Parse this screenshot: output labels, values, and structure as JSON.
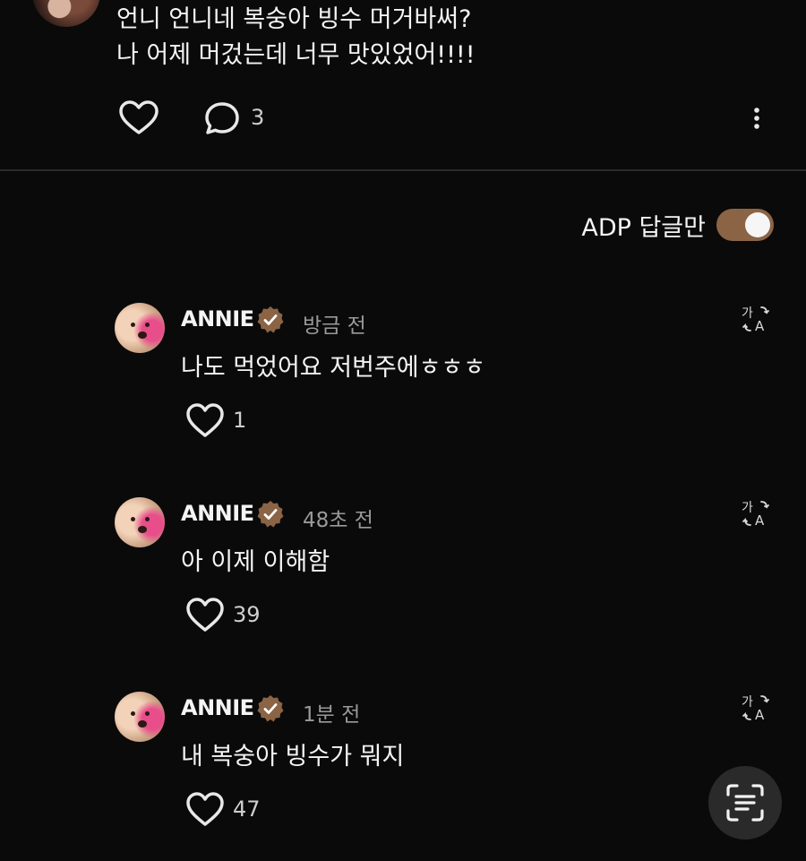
{
  "post": {
    "text": "언니 언니네 복숭아 빙수 머거바써?\n나 어제 머겄는데 너무 맛있었어!!!!",
    "reply_count": "3"
  },
  "filter": {
    "label": "ADP 답글만",
    "enabled": true
  },
  "replies": [
    {
      "author": "ANNIE",
      "time": "방금 전",
      "text": "나도 먹었어요 저번주에ㅎㅎㅎ",
      "likes": "1"
    },
    {
      "author": "ANNIE",
      "time": "48초 전",
      "text": "아 이제 이해함",
      "likes": "39"
    },
    {
      "author": "ANNIE",
      "time": "1분 전",
      "text": "내 복숭아 빙수가 뭐지",
      "likes": "47"
    }
  ],
  "colors": {
    "background": "#0b0a0a",
    "accent": "#8b6446",
    "verified_badge": "#8b6446",
    "secondary_text": "#9a9a9a"
  }
}
